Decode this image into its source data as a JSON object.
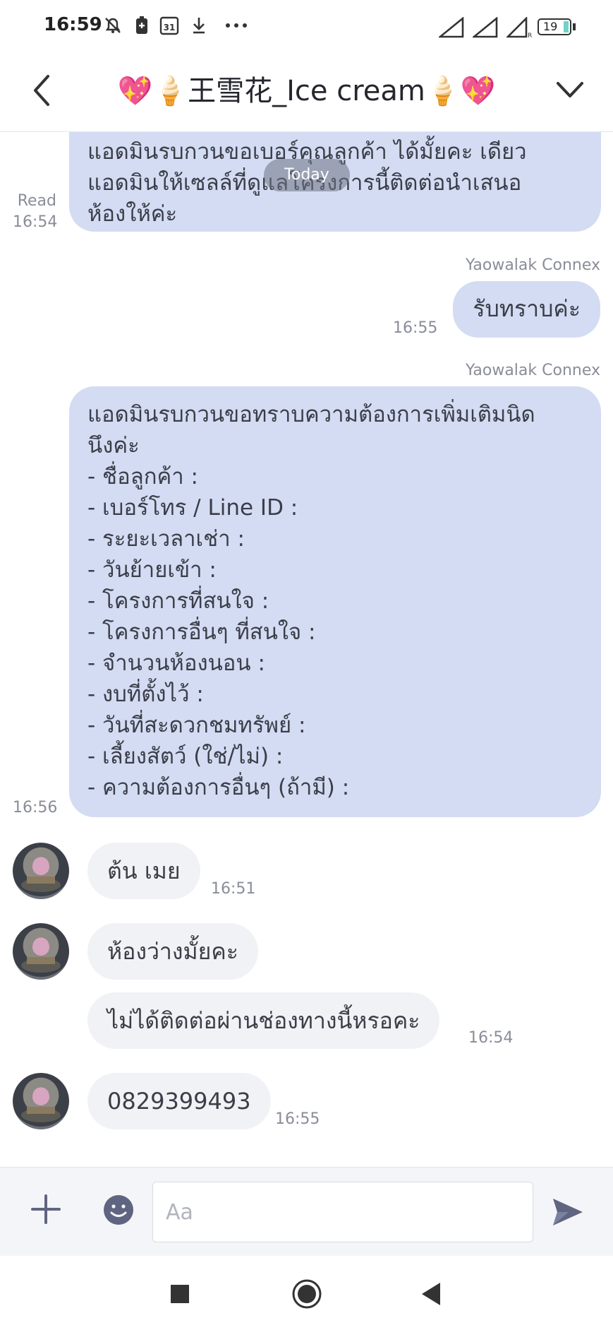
{
  "status_bar": {
    "time": "16:59",
    "battery_level": "19",
    "left_icons": [
      "notifications-muted-icon",
      "battery-saver-icon",
      "calendar-icon",
      "download-icon",
      "more-dots-icon"
    ],
    "right_icons": [
      "signal-icon",
      "signal-icon",
      "signal-icon",
      "battery-icon"
    ]
  },
  "header": {
    "title": "💖🍦王雪花_Ice cream🍦💖",
    "back_icon": "chevron-left-icon",
    "menu_icon": "chevron-down-icon"
  },
  "chat": {
    "date_divider": "Today",
    "messages": [
      {
        "direction": "out",
        "lines": [
          "แอดมินรบกวนขอเบอร์คุณลูกค้า ได้มั้ยคะ เดียว",
          "แอดมินให้เซลล์ที่ดูแลโครงการนี้ติดต่อนำเสนอ",
          "ห้องให้ค่ะ"
        ],
        "read_label": "Read",
        "time": "16:54"
      },
      {
        "direction": "out",
        "sender": "Yaowalak Connex",
        "text": "รับทราบค่ะ",
        "time": "16:55"
      },
      {
        "direction": "out",
        "sender": "Yaowalak Connex",
        "lines": [
          "แอดมินรบกวนขอทราบความต้องการเพิ่มเติมนิด",
          "นึงค่ะ",
          "- ชื่อลูกค้า :",
          "- เบอร์โทร / Line ID :",
          "- ระยะเวลาเช่า :",
          "- วันย้ายเข้า :",
          "- โครงการที่สนใจ :",
          "- โครงการอื่นๆ ที่สนใจ :",
          "- จำนวนห้องนอน :",
          "- งบที่ตั้งไว้ :",
          "- วันที่สะดวกชมทรัพย์ :",
          "- เลี้ยงสัตว์ (ใช่/ไม่) :",
          "- ความต้องการอื่นๆ (ถ้ามี) :"
        ],
        "time": "16:56"
      },
      {
        "direction": "in",
        "text": "ต้น เมย",
        "time": "16:51"
      },
      {
        "direction": "in",
        "text": "ห้องว่างมั้ยคะ",
        "time": ""
      },
      {
        "direction": "in",
        "text": "ไม่ได้ติดต่อผ่านช่องทางนี้หรอคะ",
        "time": "16:54"
      },
      {
        "direction": "in",
        "text": "0829399493",
        "time": "16:55"
      }
    ]
  },
  "input_bar": {
    "placeholder": "Aa",
    "value": "",
    "add_icon": "plus-icon",
    "emoji_icon": "emoji-icon",
    "send_icon": "send-icon"
  },
  "nav_bar": {
    "icons": [
      "recents-square-icon",
      "home-circle-icon",
      "back-triangle-icon"
    ]
  },
  "colors": {
    "outgoing_bubble": "#d3dcf3",
    "incoming_bubble": "#f1f2f5",
    "meta_text": "#8a8d98",
    "accent": "#6b7291"
  }
}
